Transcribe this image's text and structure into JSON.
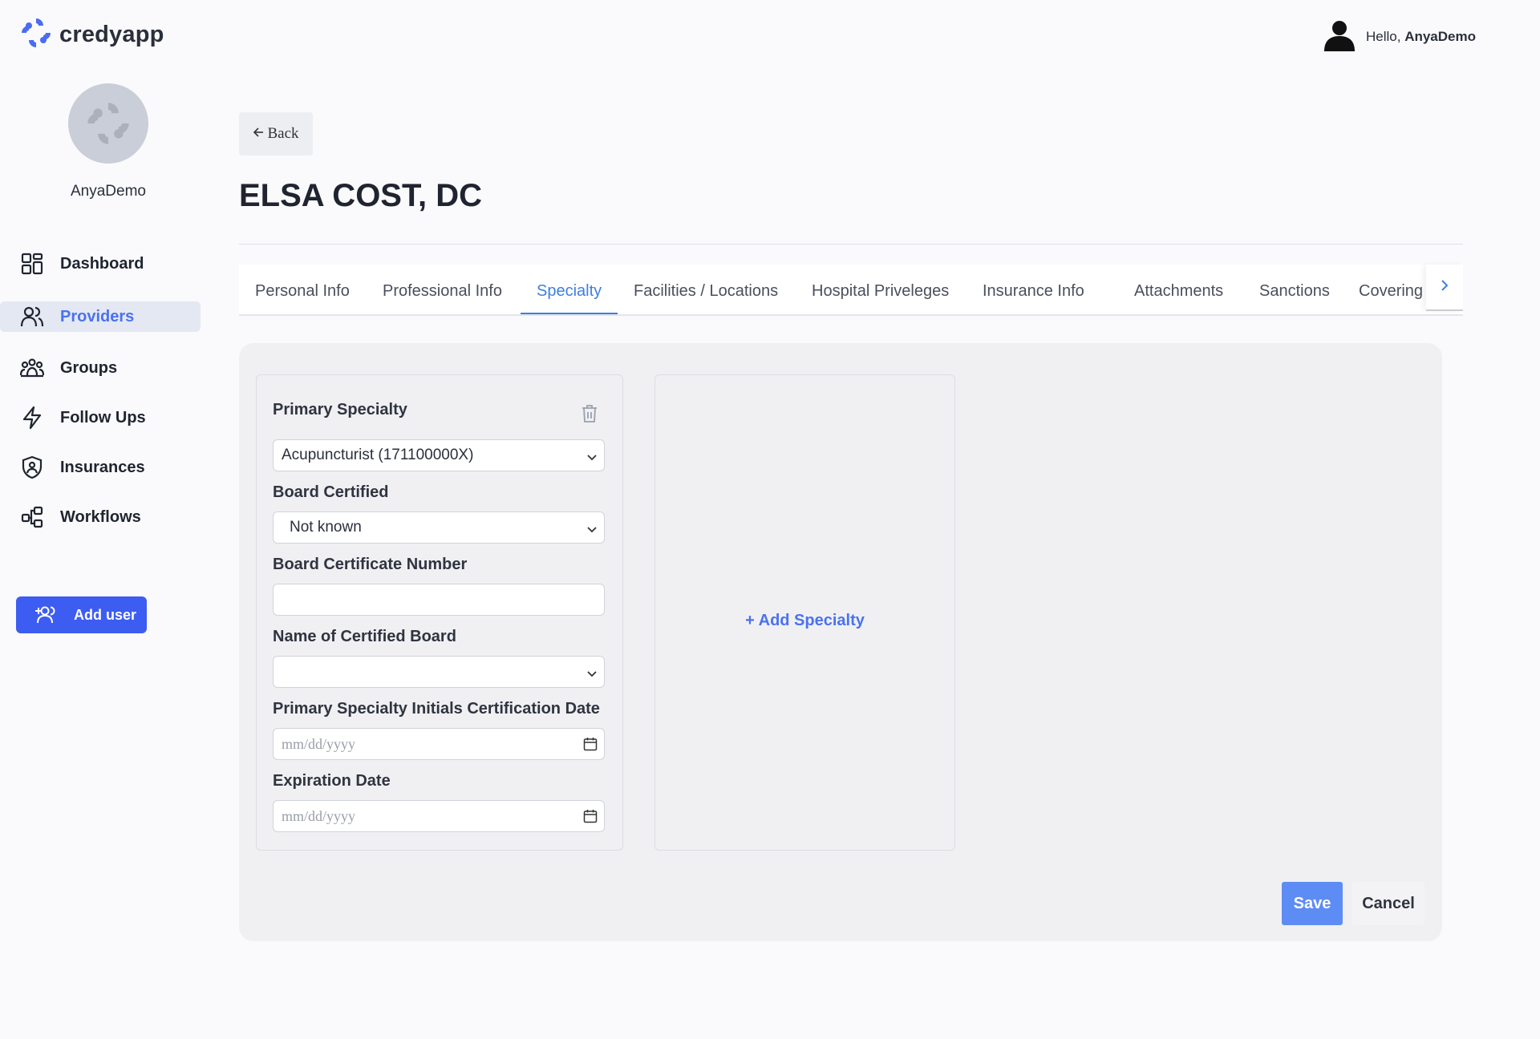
{
  "app": {
    "name": "credyapp"
  },
  "header": {
    "greeting": "Hello,",
    "username": "AnyaDemo"
  },
  "sidebar": {
    "username": "AnyaDemo",
    "items": [
      {
        "label": "Dashboard",
        "icon": "dashboard-icon",
        "active": false
      },
      {
        "label": "Providers",
        "icon": "providers-icon",
        "active": true
      },
      {
        "label": "Groups",
        "icon": "groups-icon",
        "active": false
      },
      {
        "label": "Follow Ups",
        "icon": "bolt-icon",
        "active": false
      },
      {
        "label": "Insurances",
        "icon": "shield-icon",
        "active": false
      },
      {
        "label": "Workflows",
        "icon": "workflow-icon",
        "active": false
      }
    ],
    "add_user_label": "Add user"
  },
  "main": {
    "back_label": "Back",
    "title": "ELSA COST, DC",
    "tabs": [
      {
        "label": "Personal Info"
      },
      {
        "label": "Professional Info"
      },
      {
        "label": "Specialty",
        "active": true
      },
      {
        "label": "Facilities / Locations"
      },
      {
        "label": "Hospital Priveleges"
      },
      {
        "label": "Insurance Info"
      },
      {
        "label": "Attachments"
      },
      {
        "label": "Sanctions"
      },
      {
        "label": "Covering Pr"
      }
    ]
  },
  "specialty_form": {
    "title": "Primary Specialty",
    "primary_specialty": {
      "value": "Acupuncturist (171100000X)"
    },
    "board_certified": {
      "label": "Board Certified",
      "value": "Not known"
    },
    "board_certificate_number": {
      "label": "Board Certificate Number",
      "value": ""
    },
    "certified_board_name": {
      "label": "Name of Certified Board",
      "value": ""
    },
    "initial_certification_date": {
      "label": "Primary Specialty Initials Certification Date",
      "placeholder": "mm/dd/yyyy"
    },
    "expiration_date": {
      "label": "Expiration Date",
      "placeholder": "mm/dd/yyyy"
    }
  },
  "add_specialty_label": "+ Add Specialty",
  "actions": {
    "save_label": "Save",
    "cancel_label": "Cancel"
  },
  "colors": {
    "accent": "#3d5cf2",
    "tab_active": "#3e7fe0",
    "save": "#5d8cf4"
  }
}
